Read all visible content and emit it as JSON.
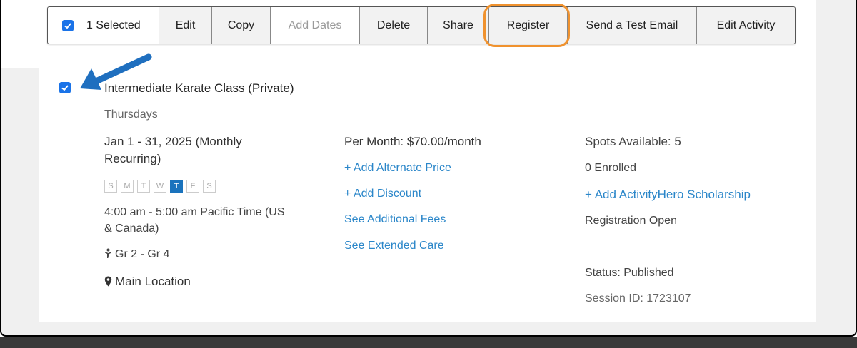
{
  "toolbar": {
    "selected_label": "1 Selected",
    "edit_label": "Edit",
    "copy_label": "Copy",
    "add_dates_label": "Add Dates",
    "delete_label": "Delete",
    "share_label": "Share",
    "register_label": "Register",
    "test_email_label": "Send a Test Email",
    "edit_activity_label": "Edit Activity"
  },
  "activity": {
    "title": "Intermediate Karate Class (Private)",
    "day_text": "Thursdays",
    "date_line1": "Jan 1 - 31, 2025 (Monthly",
    "date_line2": "Recurring)",
    "weekdays": [
      "S",
      "M",
      "T",
      "W",
      "T",
      "F",
      "S"
    ],
    "active_weekday_index": 4,
    "time_line1": "4:00 am - 5:00 am Pacific Time (US",
    "time_line2": "& Canada)",
    "grades": "Gr 2 - Gr 4",
    "location": "Main Location"
  },
  "pricing": {
    "price": "Per Month: $70.00/month",
    "add_alternate_price": "+ Add Alternate Price",
    "add_discount": "+ Add Discount",
    "see_additional_fees": "See Additional Fees",
    "see_extended_care": "See Extended Care"
  },
  "status": {
    "spots": "Spots Available: 5",
    "enrolled": "0 Enrolled",
    "add_scholarship": "+ Add ActivityHero Scholarship",
    "registration": "Registration Open",
    "publish_status": "Status: Published",
    "session_id": "Session ID: 1723107"
  },
  "colors": {
    "accent_blue": "#1a73e8",
    "link_blue": "#2a86c9",
    "highlight_orange": "#f0922e",
    "arrow_blue": "#1f6fbf"
  }
}
